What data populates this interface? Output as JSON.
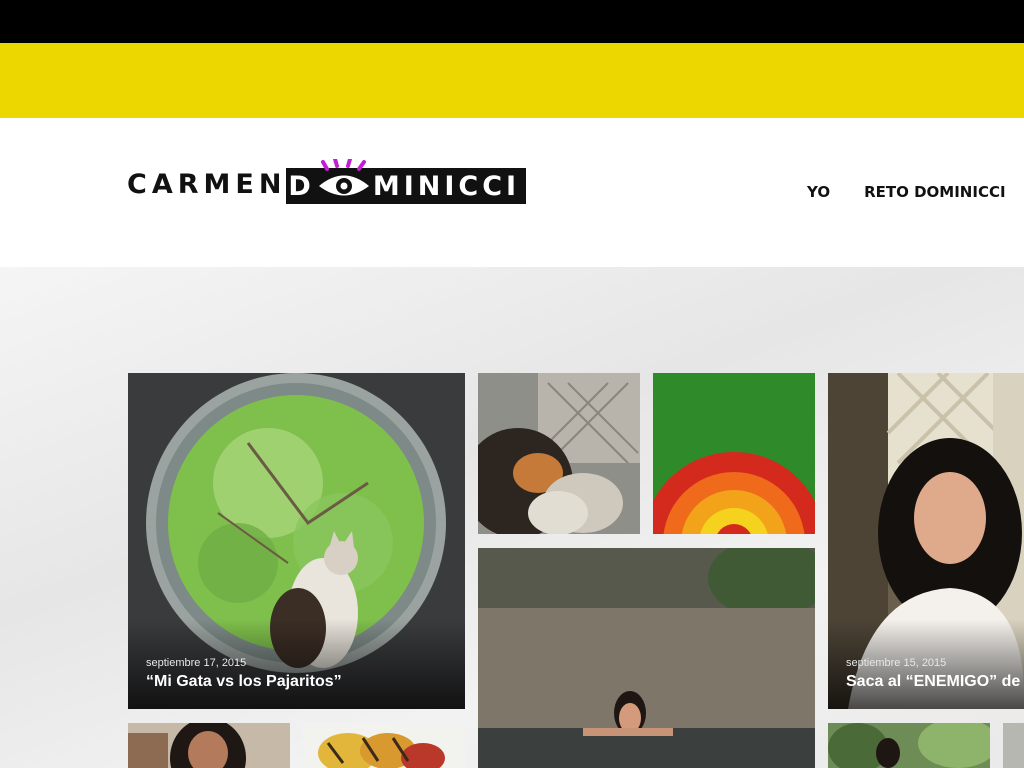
{
  "brand": {
    "first": "CARMEN",
    "last_prefix": "D",
    "last_suffix": "MINICCI",
    "accent": "#c21fd4"
  },
  "colors": {
    "topbar": "#000000",
    "banner": "#ecd800"
  },
  "nav": {
    "items": [
      "YO",
      "RETO DOMINICCI"
    ]
  },
  "posts": [
    {
      "date": "septiembre 17, 2015",
      "title": "“Mi Gata vs los Pajaritos”",
      "image": "cat in round window with tree"
    },
    {
      "date": "",
      "title": "",
      "image": "cat close-up"
    },
    {
      "date": "",
      "title": "",
      "image": "rainbow of peppers"
    },
    {
      "date": "septiembre 15, 2015",
      "title": "Saca al “ENEMIGO” de tu",
      "image": "woman smiling presenter"
    },
    {
      "date": "",
      "title": "",
      "image": "woman in hot spring pool"
    },
    {
      "date": "",
      "title": "",
      "image": "woman portrait"
    },
    {
      "date": "",
      "title": "",
      "image": "grilled vegetables"
    },
    {
      "date": "",
      "title": "",
      "image": "garden with person"
    }
  ]
}
